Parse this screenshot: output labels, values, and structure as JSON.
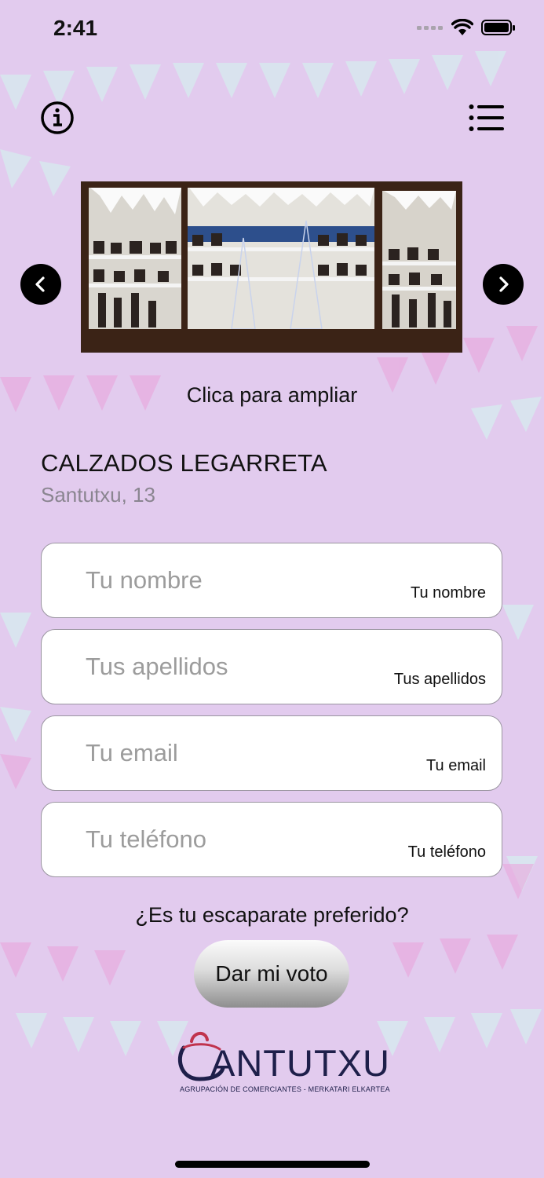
{
  "status_bar": {
    "time": "2:41"
  },
  "header": {
    "info_icon": "info-circle-icon",
    "menu_icon": "list-menu-icon"
  },
  "carousel": {
    "prev_icon": "chevron-left-icon",
    "next_icon": "chevron-right-icon",
    "caption": "Clica para ampliar"
  },
  "shop": {
    "name": "CALZADOS LEGARRETA",
    "address": "Santutxu, 13"
  },
  "form": {
    "fields": [
      {
        "placeholder": "Tu nombre",
        "hint": "Tu nombre",
        "value": ""
      },
      {
        "placeholder": "Tus apellidos",
        "hint": "Tus apellidos",
        "value": ""
      },
      {
        "placeholder": "Tu email",
        "hint": "Tu email",
        "value": ""
      },
      {
        "placeholder": "Tu teléfono",
        "hint": "Tu teléfono",
        "value": ""
      }
    ],
    "question": "¿Es tu escaparate preferido?",
    "vote_label": "Dar mi voto"
  },
  "logo": {
    "word": "ANTUTXU",
    "subtitle": "AGRUPACIÓN DE COMERCIANTES - MERKATARI ELKARTEA"
  },
  "colors": {
    "background": "#e2cbee",
    "logo_navy": "#1e1f4a",
    "logo_red": "#c0334d"
  }
}
